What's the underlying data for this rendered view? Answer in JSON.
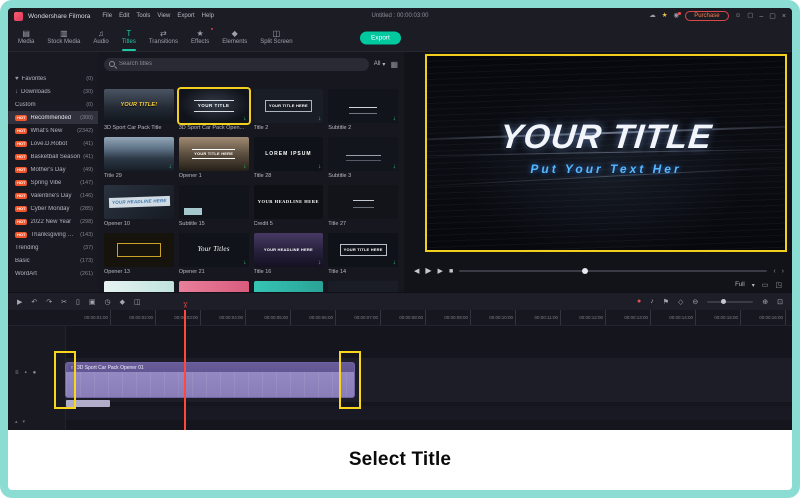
{
  "titlebar": {
    "app_name": "Wondershare Filmora",
    "menus": [
      "File",
      "Edit",
      "Tools",
      "View",
      "Export",
      "Help"
    ],
    "project_status": "Untitled : 00:00:03:00",
    "purchase": "Purchase"
  },
  "tabbar": {
    "tabs": [
      {
        "icon": "▤",
        "label": "Media",
        "dot": ""
      },
      {
        "icon": "▥",
        "label": "Stock Media",
        "dot": ""
      },
      {
        "icon": "♫",
        "label": "Audio",
        "dot": ""
      },
      {
        "icon": "T",
        "label": "Titles",
        "dot": ""
      },
      {
        "icon": "⇄",
        "label": "Transitions",
        "dot": ""
      },
      {
        "icon": "★",
        "label": "Effects",
        "dot": "●"
      },
      {
        "icon": "◆",
        "label": "Elements",
        "dot": ""
      },
      {
        "icon": "◫",
        "label": "Split Screen",
        "dot": ""
      }
    ],
    "export_label": "Export"
  },
  "search": {
    "placeholder": "Search titles",
    "filter_label": "All"
  },
  "sidebar": {
    "items": [
      {
        "icon": "♥",
        "badge": "",
        "label": "Favorites",
        "count": "(0)"
      },
      {
        "icon": "↓",
        "badge": "",
        "label": "Downloads",
        "count": "(30)"
      },
      {
        "icon": "",
        "badge": "",
        "label": "Custom",
        "count": "(0)"
      },
      {
        "icon": "",
        "badge": "HOT",
        "label": "Recommended",
        "count": "(300)"
      },
      {
        "icon": "",
        "badge": "HOT",
        "label": "What's New",
        "count": "(2342)"
      },
      {
        "icon": "",
        "badge": "HOT",
        "label": "Love.D.Robot",
        "count": "(41)"
      },
      {
        "icon": "",
        "badge": "HOT",
        "label": "Basketball Season",
        "count": "(41)"
      },
      {
        "icon": "",
        "badge": "HOT",
        "label": "Mother's Day",
        "count": "(49)"
      },
      {
        "icon": "",
        "badge": "HOT",
        "label": "Spring Vibe",
        "count": "(147)"
      },
      {
        "icon": "",
        "badge": "HOT",
        "label": "Valentine's Day",
        "count": "(146)"
      },
      {
        "icon": "",
        "badge": "HOT",
        "label": "Cyber Monday",
        "count": "(285)"
      },
      {
        "icon": "",
        "badge": "HOT",
        "label": "2022 New Year",
        "count": "(298)"
      },
      {
        "icon": "",
        "badge": "HOT",
        "label": "Thanksgiving Day",
        "count": "(143)"
      },
      {
        "icon": "",
        "badge": "",
        "label": "Trending",
        "count": "(37)"
      },
      {
        "icon": "",
        "badge": "",
        "label": "Basic",
        "count": "(173)"
      },
      {
        "icon": "",
        "badge": "",
        "label": "WordArt",
        "count": "(261)"
      }
    ]
  },
  "grid": {
    "items": [
      {
        "label": "3D Sport Car Pack Title",
        "text": "YOUR TITLE!",
        "dl": ""
      },
      {
        "label": "3D Sport Car Pack Open...",
        "text": "YOUR TITLE",
        "dl": "↓"
      },
      {
        "label": "Title 2",
        "text": "YOUR TITLE HERE",
        "dl": "↓"
      },
      {
        "label": "Subtitle 2",
        "text": "",
        "dl": "↓"
      },
      {
        "label": "Title 29",
        "text": "",
        "dl": "↓"
      },
      {
        "label": "Opener 1",
        "text": "YOUR TITLE HERE",
        "dl": "↓"
      },
      {
        "label": "Title 28",
        "text": "LOREM IPSUM",
        "dl": "↓"
      },
      {
        "label": "Subtitle 3",
        "text": "",
        "dl": "↓"
      },
      {
        "label": "Opener 10",
        "text": "YOUR HEADLINE HERE",
        "dl": ""
      },
      {
        "label": "Subtitle 15",
        "text": "",
        "dl": ""
      },
      {
        "label": "Credit 5",
        "text": "YOUR HEADLINE HERE",
        "dl": ""
      },
      {
        "label": "Title 27",
        "text": "",
        "dl": ""
      },
      {
        "label": "Opener 13",
        "text": "",
        "dl": ""
      },
      {
        "label": "Opener 21",
        "text": "Your Titles",
        "dl": "↓"
      },
      {
        "label": "Title 16",
        "text": "YOUR HEADLINE HERE",
        "dl": "↓"
      },
      {
        "label": "Title 14",
        "text": "YOUR TITLE HERE",
        "dl": "↓"
      }
    ]
  },
  "preview": {
    "title": "YOUR TITLE",
    "subtitle": "Put Your Text Her",
    "fit_label": "Full"
  },
  "timeline": {
    "ruler_labels": [
      "00:00:01:00",
      "00:00:02:00",
      "00:00:03:00",
      "00:00:04:00",
      "00:00:05:00",
      "00:00:06:00",
      "00:00:07:00",
      "00:00:08:00",
      "00:00:09:00",
      "00:00:10:00",
      "00:00:11:00",
      "00:00:12:00",
      "00:00:13:00",
      "00:00:14:00",
      "00:00:15:00",
      "00:00:16:00"
    ],
    "clip_label": "3D Sport Car Pack Opener 01"
  },
  "caption": {
    "text": "Select Title"
  },
  "colors": {
    "frame_border": "#8bdcd3",
    "accent_teal": "#00c9a0",
    "highlight_yellow": "#f2cf1d",
    "clip_purple": "#9488c2",
    "hot_badge": "#f2552c",
    "purchase_red": "#d94848",
    "record_red": "#e25555",
    "subtitle_blue": "#57b7ff",
    "playhead_red": "#ff473c"
  },
  "icons": {
    "cloud": "☁",
    "tips": "★",
    "bell": "◉",
    "user": "☺",
    "workspace": "▢",
    "minimize": "–",
    "maximize": "▢",
    "close": "×",
    "dropdown": "▾",
    "grid_view": "▦",
    "prev": "◀",
    "play": "▶",
    "next": "▶",
    "stop": "■",
    "bracket_l": "‹",
    "bracket_r": "›",
    "monitor": "▭",
    "fullscreen": "◳",
    "pointer": "▶",
    "undo": "↶",
    "redo": "↷",
    "scissors": "✂",
    "trash": "▯",
    "crop": "▣",
    "speed": "◷",
    "marker": "⚑",
    "split_clip": "◫",
    "keyframe": "◆",
    "record": "●",
    "mic": "♪",
    "flag": "⚑",
    "magnet": "◇",
    "zoom_out": "⊖",
    "zoom_in": "⊕",
    "fit": "⊡",
    "track_menu": "≡",
    "track_lock": "▪",
    "track_eye": "●",
    "up": "▴",
    "down": "▾",
    "clip_type": "T",
    "playhead": "✂"
  }
}
